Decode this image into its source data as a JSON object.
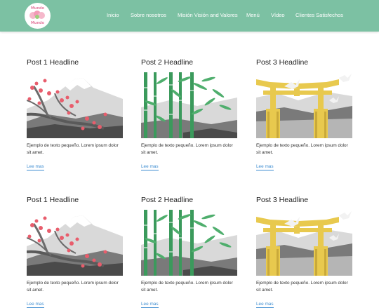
{
  "header": {
    "logo_text_top": "Mundo",
    "logo_text_bottom": "Mundo",
    "bg_color": "#7cc1a3",
    "nav": [
      "Inicio",
      "Sobre nosotros",
      "Misión Visión and Valores",
      "Menú",
      "Vídeo",
      "Clientes Satisfechos"
    ]
  },
  "posts": [
    {
      "title": "Post 1 Headline",
      "excerpt": "Ejemplo de texto pequeño. Lorem ipsum dolor sit amet.",
      "link": "Lee mas",
      "image": "mountain-blossom"
    },
    {
      "title": "Post 2 Headline",
      "excerpt": "Ejemplo de texto pequeño. Lorem ipsum dolor sit amet.",
      "link": "Lee mas",
      "image": "bamboo"
    },
    {
      "title": "Post 3 Headline",
      "excerpt": "Ejemplo de texto pequeño. Lorem ipsum dolor sit amet.",
      "link": "Lee mas",
      "image": "torii-gate"
    },
    {
      "title": "Post 1 Headline",
      "excerpt": "Ejemplo de texto pequeño. Lorem ipsum dolor sit amet.",
      "link": "Lee mas",
      "image": "mountain-blossom"
    },
    {
      "title": "Post 2 Headline",
      "excerpt": "Ejemplo de texto pequeño. Lorem ipsum dolor sit amet.",
      "link": "Lee mas",
      "image": "bamboo"
    },
    {
      "title": "Post 3 Headline",
      "excerpt": "Ejemplo de texto pequeño. Lorem ipsum dolor sit amet.",
      "link": "Lee mas",
      "image": "torii-gate"
    }
  ]
}
